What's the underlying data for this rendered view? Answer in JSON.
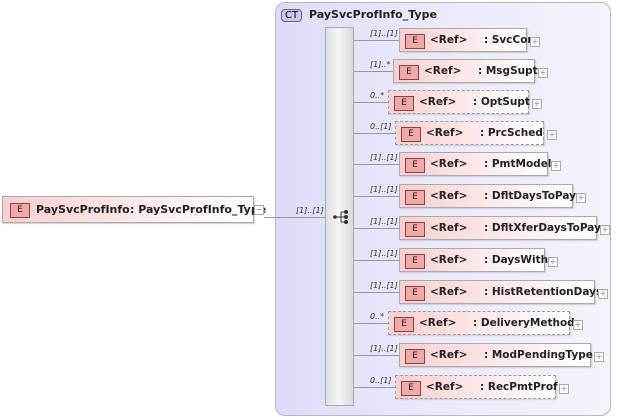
{
  "complex_type": {
    "badge": "CT",
    "name": "PaySvcProfInfo_Type"
  },
  "root": {
    "badge": "E",
    "name": "PaySvcProfInfo",
    "type": ": PaySvcProfInfo_Type",
    "multiplicity": "[1]..[1]",
    "expander": "−"
  },
  "compositor": {
    "icon": "sequence-icon"
  },
  "children": [
    {
      "badge": "E",
      "ref": "<Ref>",
      "name": ": SvcCore",
      "multiplicity": "[1]..[1]",
      "optional": false,
      "expander": "+"
    },
    {
      "badge": "E",
      "ref": "<Ref>",
      "name": ": MsgSupt",
      "multiplicity": "[1]..*",
      "optional": false,
      "expander": "+"
    },
    {
      "badge": "E",
      "ref": "<Ref>",
      "name": ": OptSupt",
      "multiplicity": "0..*",
      "optional": true,
      "expander": "+"
    },
    {
      "badge": "E",
      "ref": "<Ref>",
      "name": ": PrcSched",
      "multiplicity": "0..[1]",
      "optional": true,
      "expander": "+"
    },
    {
      "badge": "E",
      "ref": "<Ref>",
      "name": ": PmtModel",
      "multiplicity": "[1]..[1]",
      "optional": false,
      "expander": "+"
    },
    {
      "badge": "E",
      "ref": "<Ref>",
      "name": ": DfltDaysToPay",
      "multiplicity": "[1]..[1]",
      "optional": false,
      "expander": "+"
    },
    {
      "badge": "E",
      "ref": "<Ref>",
      "name": ": DfltXferDaysToPay",
      "multiplicity": "[1]..[1]",
      "optional": false,
      "expander": "+"
    },
    {
      "badge": "E",
      "ref": "<Ref>",
      "name": ": DaysWith",
      "multiplicity": "[1]..[1]",
      "optional": false,
      "expander": "+"
    },
    {
      "badge": "E",
      "ref": "<Ref>",
      "name": ": HistRetentionDays",
      "multiplicity": "[1]..[1]",
      "optional": false,
      "expander": "+"
    },
    {
      "badge": "E",
      "ref": "<Ref>",
      "name": ": DeliveryMethod",
      "multiplicity": "0..*",
      "optional": true,
      "expander": "+"
    },
    {
      "badge": "E",
      "ref": "<Ref>",
      "name": ": ModPendingType",
      "multiplicity": "[1]..[1]",
      "optional": false,
      "expander": "+"
    },
    {
      "badge": "E",
      "ref": "<Ref>",
      "name": ": RecPmtProf",
      "multiplicity": "0..[1]",
      "optional": true,
      "expander": "+"
    }
  ]
}
